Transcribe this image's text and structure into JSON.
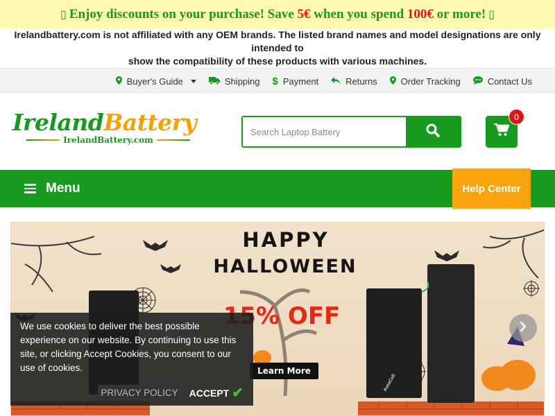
{
  "promo": {
    "box_left": "▯",
    "text_before": "Enjoy discounts on your purchase! Save ",
    "save_amount": "5€",
    "text_middle": " when you spend ",
    "spend_amount": "100€",
    "text_after": " or more!",
    "box_right": "▯"
  },
  "disclaimer": {
    "line1": "Irelandbattery.com is not affiliated with any OEM brands. The listed brand names and model designations are only intended to",
    "line2": "show the compatibility of these products with various machines."
  },
  "topnav": {
    "buyers_guide": "Buyer's Guide",
    "shipping": "Shipping",
    "payment": "Payment",
    "returns": "Returns",
    "order_tracking": "Order Tracking",
    "contact_us": "Contact Us"
  },
  "logo": {
    "part1": "Ireland",
    "part2": "Battery",
    "sub": "IrelandBattery.com"
  },
  "search": {
    "placeholder": "Search Laptop Battery",
    "value": ""
  },
  "cart": {
    "count": "0"
  },
  "mainnav": {
    "menu_label": "Menu",
    "help_label": "Help Center"
  },
  "banner": {
    "line1": "HAPPY",
    "line2": "HALLOWEEN",
    "discount": "15% OFF",
    "cta": "Learn More",
    "battery_brand": "AstaCell"
  },
  "cookie": {
    "message": "We use cookies to deliver the best possible experience on our website. By continuing to use this site, or clicking Accept Cookies, you consent to our use of cookies.",
    "policy": "PRIVACY POLICY",
    "accept": "ACCEPT"
  },
  "colors": {
    "brand_green": "#189a1e",
    "accent_orange": "#f9a40c",
    "promo_bg": "#fdfab0",
    "highlight_red": "#e01515"
  },
  "icons": {
    "buyers_guide": "map-marker-icon",
    "shipping": "truck-icon",
    "payment": "dollar-icon",
    "returns": "reply-icon",
    "order_tracking": "map-marker-icon",
    "contact_us": "chat-icon",
    "search": "search-icon",
    "cart": "cart-icon",
    "menu": "hamburger-icon",
    "slider_next": "chevron-right-icon"
  }
}
